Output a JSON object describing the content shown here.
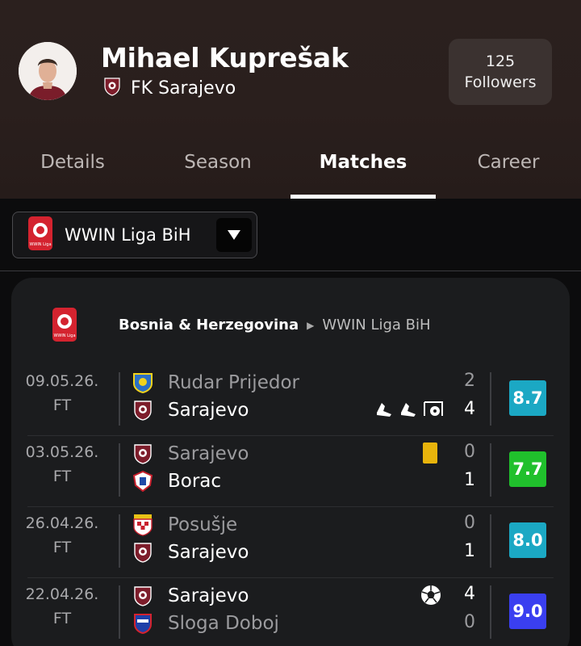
{
  "player": {
    "name": "Mihael Kuprešak",
    "club": "FK Sarajevo",
    "followers_count": "125",
    "followers_label": "Followers"
  },
  "tabs": [
    {
      "label": "Details"
    },
    {
      "label": "Season"
    },
    {
      "label": "Matches",
      "active": true
    },
    {
      "label": "Career"
    }
  ],
  "league_select": {
    "value": "WWIN Liga BiH",
    "logo_text": "WWIN Liga"
  },
  "competition": {
    "country": "Bosnia & Herzegovina",
    "league": "WWIN Liga BiH"
  },
  "matches": [
    {
      "date": "09.05.26.",
      "status": "FT",
      "home": {
        "name": "Rudar Prijedor",
        "score": "2",
        "dim": true
      },
      "away": {
        "name": "Sarajevo",
        "score": "4",
        "dim": false
      },
      "rating": "8.7",
      "rating_color": "#1ba8c4",
      "events": [
        "assist-icon",
        "assist-icon",
        "goal-post-icon"
      ]
    },
    {
      "date": "03.05.26.",
      "status": "FT",
      "home": {
        "name": "Sarajevo",
        "score": "0",
        "dim": true
      },
      "away": {
        "name": "Borac",
        "score": "1",
        "dim": false
      },
      "rating": "7.7",
      "rating_color": "#20c02c",
      "events": [
        "yellow-card-icon"
      ]
    },
    {
      "date": "26.04.26.",
      "status": "FT",
      "home": {
        "name": "Posušje",
        "score": "0",
        "dim": true
      },
      "away": {
        "name": "Sarajevo",
        "score": "1",
        "dim": false
      },
      "rating": "8.0",
      "rating_color": "#1ba8c4",
      "events": []
    },
    {
      "date": "22.04.26.",
      "status": "FT",
      "home": {
        "name": "Sarajevo",
        "score": "4",
        "dim": false
      },
      "away": {
        "name": "Sloga Doboj",
        "score": "0",
        "dim": true
      },
      "rating": "9.0",
      "rating_color": "#3a3ff0",
      "events": [
        "football-icon"
      ]
    }
  ],
  "colors": {
    "accent_bg": "#2b201e",
    "card_bg": "#1b1c1e",
    "yellow_card": "#e8b40c"
  }
}
